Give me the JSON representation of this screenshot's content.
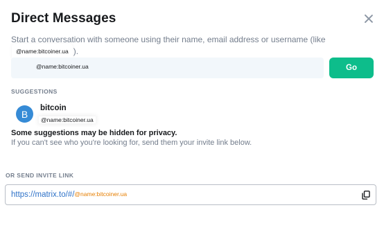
{
  "dialog": {
    "title": "Direct Messages",
    "close_icon": "close-icon"
  },
  "intro": {
    "text": "Start a conversation with someone using their name, email address or username (like",
    "example_user": "@name:bitcoiner.ua",
    "suffix": ")."
  },
  "search": {
    "value": "@name:bitcoiner.ua",
    "go_label": "Go"
  },
  "suggestions": {
    "label": "SUGGESTIONS",
    "items": [
      {
        "avatar_letter": "B",
        "name": "bitcoin",
        "user_id": "@name:bitcoiner.ua",
        "avatar_color": "#368bd6"
      }
    ],
    "privacy_heading": "Some suggestions may be hidden for privacy.",
    "privacy_text": "If you can't see who you're looking for, send them your invite link below."
  },
  "invite": {
    "label": "OR SEND INVITE LINK",
    "link_prefix": "https://matrix.to/#/",
    "link_user": "@name:bitcoiner.ua",
    "copy_icon": "copy-icon"
  },
  "colors": {
    "accent": "#0dbd8b",
    "link": "#2e72c8",
    "muted": "#737d8c"
  }
}
